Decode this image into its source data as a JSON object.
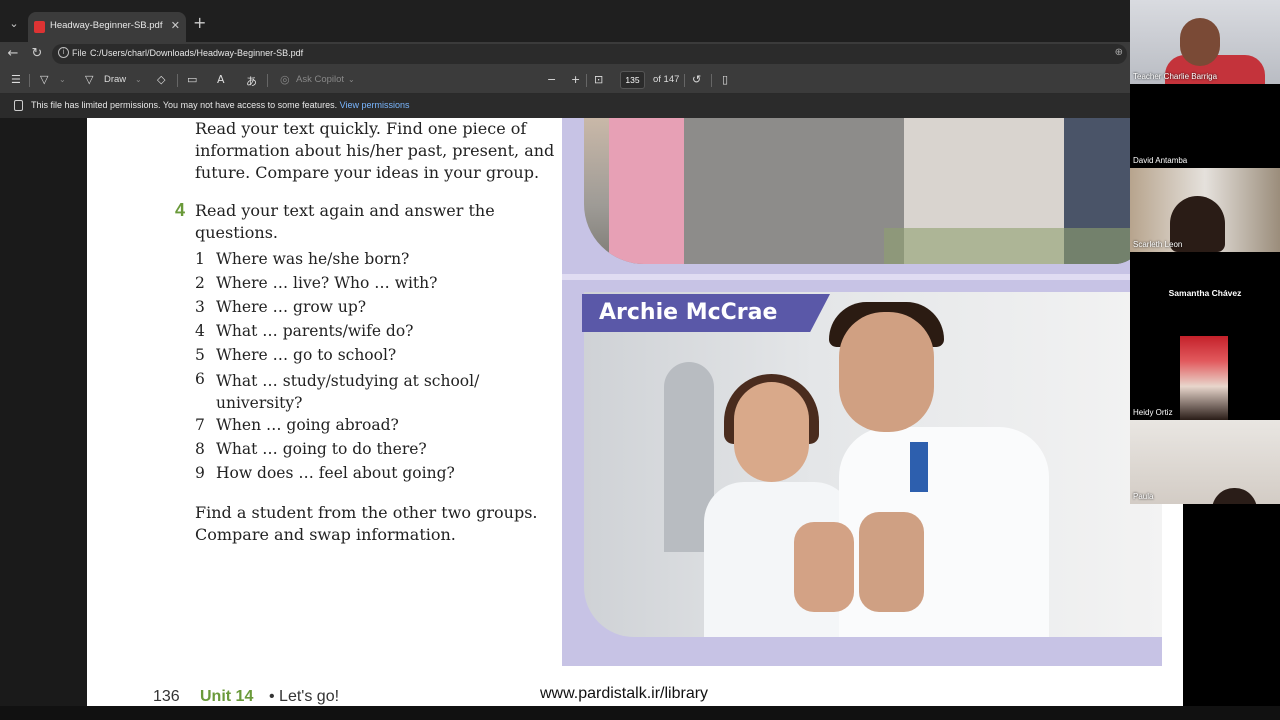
{
  "browser": {
    "tab_title": "Headway-Beginner-SB.pdf",
    "address_label": "File",
    "address_url": "C:/Users/charl/Downloads/Headway-Beginner-SB.pdf"
  },
  "pdf_toolbar": {
    "draw_label": "Draw",
    "copilot_label": "Ask Copilot",
    "page_current": "135",
    "page_total": "of 147"
  },
  "permission_bar": {
    "message": "This file has limited permissions. You may not have access to some features.",
    "link": "View permissions"
  },
  "document": {
    "intro_lines": [
      "Read your text quickly. Find one piece of",
      "information about his/her past, present, and",
      "future. Compare your ideas in your group."
    ],
    "q4_number": "4",
    "q4_lines": [
      "Read your text again and answer the",
      "questions."
    ],
    "questions": [
      {
        "n": "1",
        "t": "Where was he/she born?"
      },
      {
        "n": "2",
        "t": "Where … live? Who … with?"
      },
      {
        "n": "3",
        "t": "Where … grow up?"
      },
      {
        "n": "4",
        "t": "What … parents/wife do?"
      },
      {
        "n": "5",
        "t": "Where … go to school?"
      },
      {
        "n": "6",
        "t": "What … study/studying at school/ university?"
      },
      {
        "n": "7",
        "t": "When … going abroad?"
      },
      {
        "n": "8",
        "t": "What … going to do there?"
      },
      {
        "n": "9",
        "t": "How does … feel about going?"
      }
    ],
    "closing_lines": [
      "Find a student from the other two groups.",
      "Compare and swap information."
    ],
    "photo_name": "Archie McCrae",
    "footer_page": "136",
    "footer_unit": "Unit 14",
    "footer_title": "•  Let's go!",
    "watermark": "www.pardistalk.ir/library"
  },
  "participants": [
    {
      "name": "Teacher Charlie Barriga"
    },
    {
      "name": "David Antamba"
    },
    {
      "name": "Scarleth Leon"
    },
    {
      "name": "Samantha Chávez"
    },
    {
      "name": "Heidy Ortiz"
    },
    {
      "name": "Paula"
    }
  ],
  "colors": {
    "accent_green": "#6a9a3a",
    "banner_purple": "#5a58a8",
    "link_blue": "#7ab7ff"
  }
}
